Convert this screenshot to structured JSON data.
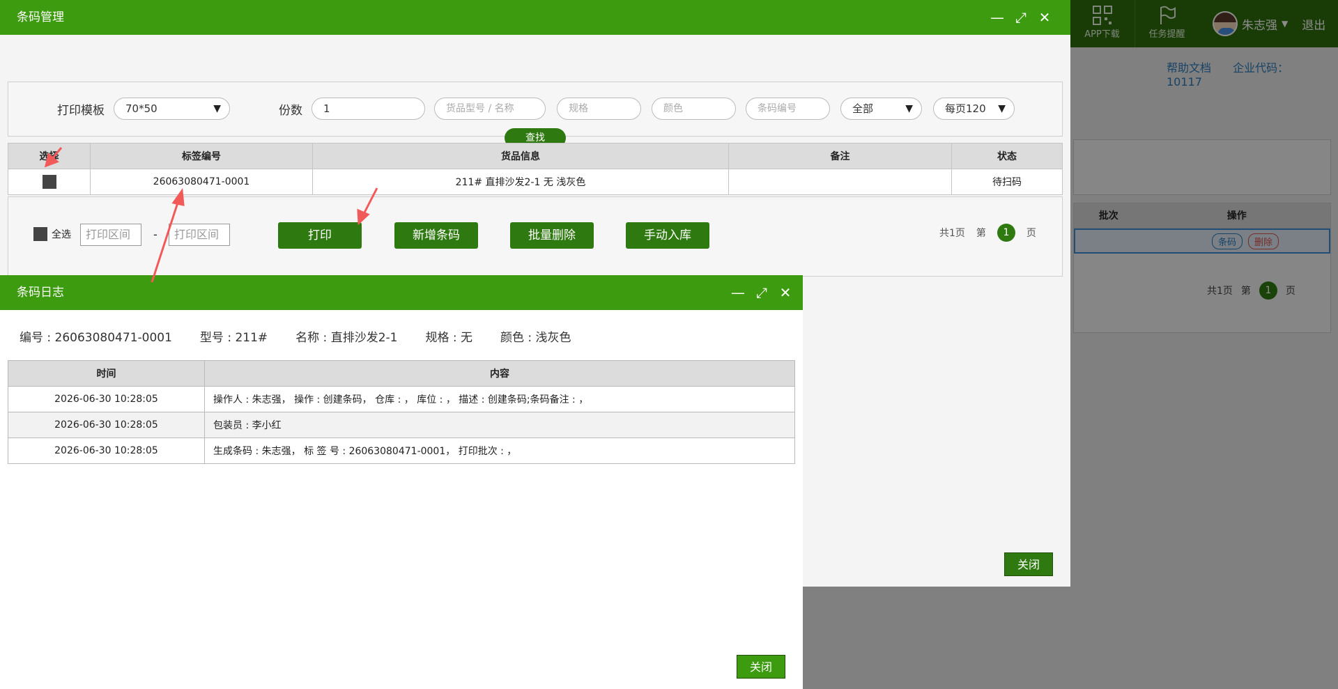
{
  "background_app": {
    "top_actions": [
      {
        "label": "APP下载",
        "icon": "qrcode-icon"
      },
      {
        "label": "任务提醒",
        "icon": "flag-icon"
      }
    ],
    "user_name": "朱志强",
    "logout": "退出",
    "help_link": "帮助文档",
    "company_code": "企业代码：10117",
    "table_headers": [
      "批次",
      "操作"
    ],
    "row_actions": [
      "条码",
      "删除"
    ],
    "pager": {
      "total": "共1页",
      "page_prefix": "第",
      "current": "1",
      "page_suffix": "页"
    }
  },
  "barcode_window": {
    "title": "条码管理",
    "filters": {
      "template_label": "打印模板",
      "template_value": "70*50",
      "copies_label": "份数",
      "copies_value": "1",
      "model_placeholder": "货品型号 / 名称",
      "spec_placeholder": "规格",
      "color_placeholder": "颜色",
      "code_placeholder": "条码编号",
      "status_value": "全部",
      "page_size_value": "每页120",
      "search_label": "查找"
    },
    "table": {
      "headers": [
        "选择",
        "标签编号",
        "货品信息",
        "备注",
        "状态"
      ],
      "rows": [
        {
          "code": "26063080471-0001",
          "goods": "211# 直排沙发2-1 无 浅灰色",
          "remark": "",
          "status": "待扫码"
        }
      ]
    },
    "bottom": {
      "select_all": "全选",
      "range_from_placeholder": "打印区间",
      "range_sep": "-",
      "range_to_placeholder": "打印区间",
      "buttons": [
        "打印",
        "新增条码",
        "批量删除",
        "手动入库"
      ],
      "pager": {
        "total": "共1页",
        "page_prefix": "第",
        "current": "1",
        "page_suffix": "页"
      }
    },
    "close_label": "关闭"
  },
  "log_window": {
    "title": "条码日志",
    "info": {
      "code": "编号 : 26063080471-0001",
      "model": "型号 : 211#",
      "name": "名称 : 直排沙发2-1",
      "spec": "规格 : 无",
      "color": "颜色 : 浅灰色"
    },
    "table": {
      "headers": [
        "时间",
        "内容"
      ],
      "rows": [
        {
          "time": "2026-06-30 10:28:05",
          "content": "操作人 : 朱志强， 操作 : 创建条码， 仓库 : ， 库位 : ， 描述 : 创建条码;条码备注 : ，"
        },
        {
          "time": "2026-06-30 10:28:05",
          "content": "包装员 : 李小红"
        },
        {
          "time": "2026-06-30 10:28:05",
          "content": "生成条码 : 朱志强， 标 签 号 : 26063080471-0001， 打印批次 : ，"
        }
      ]
    },
    "close_label": "关闭"
  },
  "colors": {
    "brand_green": "#3c9b0e",
    "button_green": "#2f7a10",
    "annotation_red": "#f25a5a"
  }
}
